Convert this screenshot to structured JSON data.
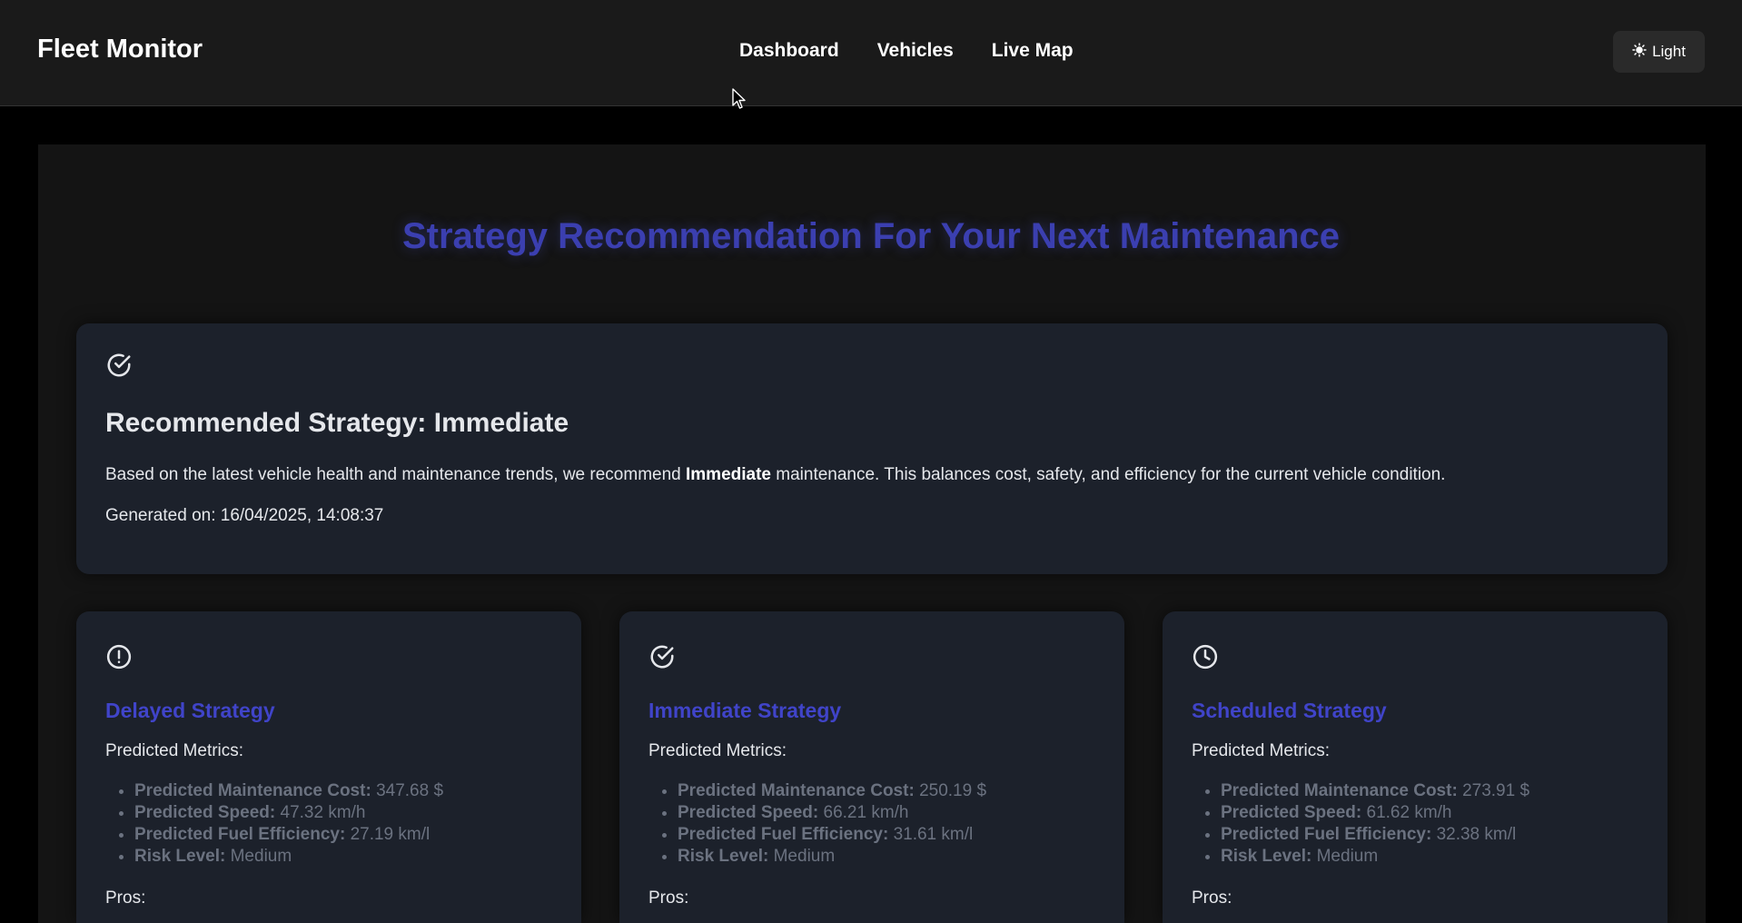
{
  "header": {
    "brand": "Fleet Monitor",
    "nav": [
      "Dashboard",
      "Vehicles",
      "Live Map"
    ],
    "theme_toggle": {
      "icon": "sun-icon",
      "label": "Light"
    }
  },
  "page": {
    "title": "Strategy Recommendation For Your Next Maintenance"
  },
  "recommendation": {
    "icon": "check-circle-icon",
    "title": "Recommended Strategy: Immediate",
    "desc_prefix": "Based on the latest vehicle health and maintenance trends, we recommend ",
    "desc_strategy": "Immediate",
    "desc_suffix": " maintenance. This balances cost, safety, and efficiency for the current vehicle condition.",
    "generated": "Generated on: 16/04/2025, 14:08:37"
  },
  "strategies": [
    {
      "icon": "alert-circle-icon",
      "title": "Delayed Strategy",
      "metrics_label": "Predicted Metrics:",
      "metrics": [
        {
          "label": "Predicted Maintenance Cost:",
          "value": "347.68 $"
        },
        {
          "label": "Predicted Speed:",
          "value": "47.32 km/h"
        },
        {
          "label": "Predicted Fuel Efficiency:",
          "value": "27.19 km/l"
        },
        {
          "label": "Risk Level:",
          "value": "Medium"
        }
      ],
      "pros_label": "Pros:"
    },
    {
      "icon": "check-circle-icon",
      "title": "Immediate Strategy",
      "metrics_label": "Predicted Metrics:",
      "metrics": [
        {
          "label": "Predicted Maintenance Cost:",
          "value": "250.19 $"
        },
        {
          "label": "Predicted Speed:",
          "value": "66.21 km/h"
        },
        {
          "label": "Predicted Fuel Efficiency:",
          "value": "31.61 km/l"
        },
        {
          "label": "Risk Level:",
          "value": "Medium"
        }
      ],
      "pros_label": "Pros:"
    },
    {
      "icon": "clock-icon",
      "title": "Scheduled Strategy",
      "metrics_label": "Predicted Metrics:",
      "metrics": [
        {
          "label": "Predicted Maintenance Cost:",
          "value": "273.91 $"
        },
        {
          "label": "Predicted Speed:",
          "value": "61.62 km/h"
        },
        {
          "label": "Predicted Fuel Efficiency:",
          "value": "32.38 km/l"
        },
        {
          "label": "Risk Level:",
          "value": "Medium"
        }
      ],
      "pros_label": "Pros:"
    }
  ]
}
